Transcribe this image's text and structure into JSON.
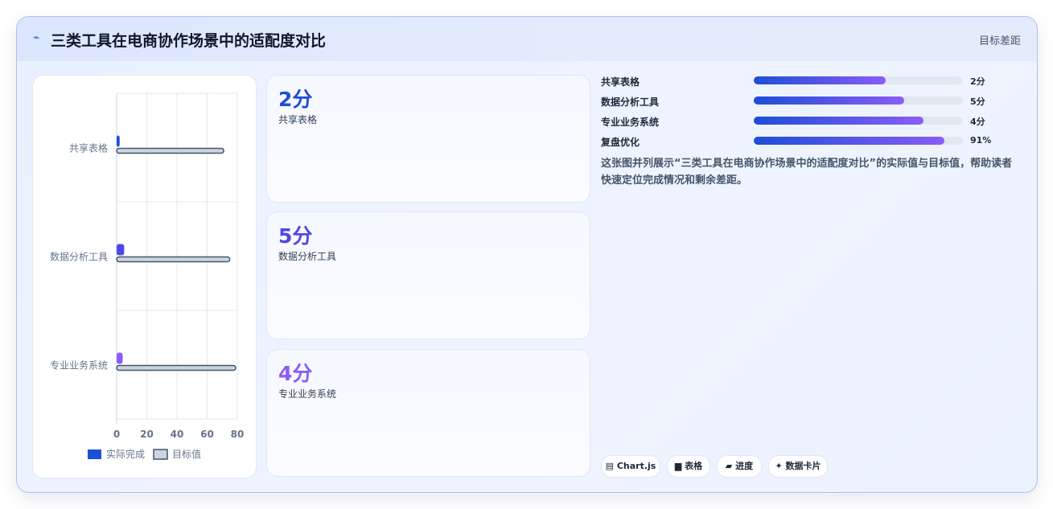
{
  "header": {
    "icon": "chart-line-icon",
    "title": "三类工具在电商协作场景中的适配度对比",
    "subtitle": "目标差距"
  },
  "chart_data": {
    "type": "bar",
    "orientation": "horizontal",
    "categories": [
      "共享表格",
      "数据分析工具",
      "专业业务系统"
    ],
    "series": [
      {
        "name": "实际完成",
        "values": [
          2,
          5,
          4
        ],
        "colors": [
          "#1d4ed8",
          "#4f46e5",
          "#8b5cf6"
        ]
      },
      {
        "name": "目标值",
        "values": [
          71,
          75,
          79
        ],
        "color": "#cbd5e1",
        "border": "#475569"
      }
    ],
    "xlim": [
      0,
      80
    ],
    "xticks": [
      "0",
      "20",
      "40",
      "60",
      "80"
    ],
    "grid": true,
    "legend": "bottom"
  },
  "kpis": [
    {
      "value": "2分",
      "label": "共享表格",
      "color": "#1d4ed8"
    },
    {
      "value": "5分",
      "label": "数据分析工具",
      "color": "#4f46e5"
    },
    {
      "value": "4分",
      "label": "专业业务系统",
      "color": "#8b5cf6"
    }
  ],
  "progress": [
    {
      "label": "共享表格",
      "value_text": "2分",
      "fraction": 0.63
    },
    {
      "label": "数据分析工具",
      "value_text": "5分",
      "fraction": 0.72
    },
    {
      "label": "专业业务系统",
      "value_text": "4分",
      "fraction": 0.81
    },
    {
      "label": "复盘优化",
      "value_text": "91%",
      "fraction": 0.91
    }
  ],
  "description": "这张图并列展示“三类工具在电商协作场景中的适配度对比”的实际值与目标值，帮助读者快速定位完成情况和剩余差距。",
  "tags": [
    {
      "label": "▤ Chart.js",
      "icon": "chart-icon"
    },
    {
      "label": "▆ 表格",
      "icon": "table-icon"
    },
    {
      "label": "▰ 进度",
      "icon": "progress-icon"
    },
    {
      "label": "✦ 数据卡片",
      "icon": "sparkle-icon"
    }
  ]
}
